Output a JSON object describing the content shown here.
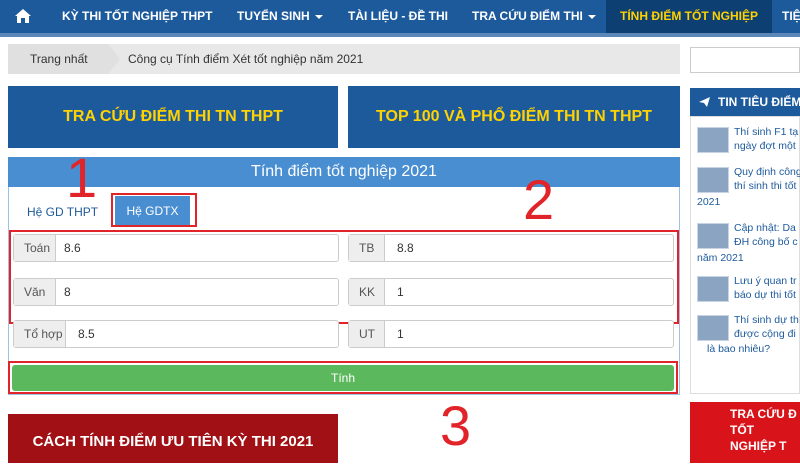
{
  "nav": {
    "items": [
      "KỲ THI TỐT NGHIỆP THPT",
      "TUYỂN SINH",
      "TÀI LIỆU - ĐỀ THI",
      "TRA CỨU ĐIỂM THI",
      "TÍNH ĐIỂM TỐT NGHIỆP",
      "TIỆ"
    ],
    "active_color": "#ffd200",
    "bar_color": "#1d5a9c"
  },
  "breadcrumb": {
    "home": "Trang nhất",
    "current": "Công cụ Tính điểm Xét tốt nghiệp năm 2021"
  },
  "buttons": {
    "lookup": "TRA CỨU ĐIỂM THI TN THPT",
    "top100": "TOP 100 VÀ PHỔ ĐIỂM THI TN THPT"
  },
  "panel": {
    "title": "Tính điểm tốt nghiệp 2021",
    "tabs": [
      "Hệ GD THPT",
      "Hệ GDTX"
    ],
    "fields": [
      {
        "label": "Toán",
        "value": "8.6"
      },
      {
        "label": "TB",
        "value": "8.8"
      },
      {
        "label": "Văn",
        "value": "8"
      },
      {
        "label": "KK",
        "value": "1"
      },
      {
        "label": "Tổ hợp",
        "value": "8.5"
      },
      {
        "label": "UT",
        "value": "1"
      }
    ],
    "calc_label": "Tính"
  },
  "annotations": [
    "1",
    "2",
    "3"
  ],
  "bottom_banner": "CÁCH TÍNH ĐIỂM ƯU TIÊN KỲ THI 2021",
  "sidebar": {
    "title": "TIN TIÊU ĐIỂM",
    "items": [
      {
        "lines": [
          "Thí sinh F1 tạ",
          "ngày đợt một"
        ]
      },
      {
        "lines": [
          "Quy định công",
          "thí sinh thi tốt"
        ],
        "extra": "2021"
      },
      {
        "lines": [
          "Cập nhật: Da",
          "ĐH công bố c"
        ],
        "extra": "năm 2021"
      },
      {
        "lines": [
          "Lưu ý quan tr",
          "báo dự thi tốt"
        ]
      },
      {
        "lines": [
          "Thí sinh dự th",
          "được cộng đi"
        ],
        "extra": "là bao nhiêu?"
      }
    ],
    "banner": [
      "TRA CỨU Đ",
      "TỐT NGHIỆP T"
    ]
  }
}
